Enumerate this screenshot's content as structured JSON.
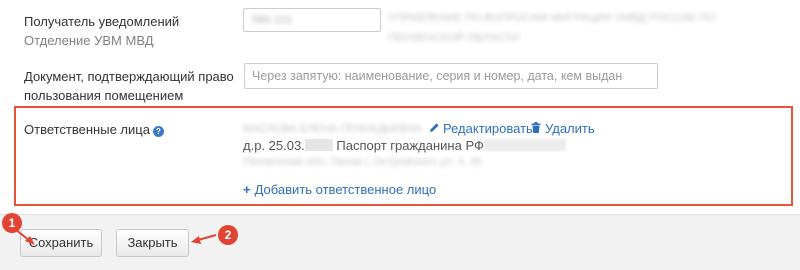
{
  "recipient": {
    "label": "Получатель уведомлений",
    "sublabel": "Отделение УВМ МВД",
    "code_value": "580-101",
    "authority_line1": "УПРАВЛЕНИЕ ПО ВОПРОСАМ МИГРАЦИИ УМВД РОССИИ ПО",
    "authority_line2": "ПЕНЗЕНСКОЙ ОБЛАСТИ"
  },
  "document": {
    "label": "Документ, подтверждающий право пользования помещением",
    "placeholder": "Через запятую: наименование, серия и номер, дата, кем выдан"
  },
  "responsible": {
    "label": "Ответственные лица",
    "help_icon": "question-circle-icon",
    "person_name": "МАСЛОВА ЕЛЕНА ГЕННАДЬЕВНА",
    "edit_label": "Редактировать",
    "edit_icon": "pencil-icon",
    "delete_label": "Удалить",
    "delete_icon": "trash-icon",
    "birth_prefix": "д.р. 25.03.",
    "passport_label": "Паспорт гражданина РФ",
    "address": "Пензенская обл, Пенза г, Островского ул, 4, 35",
    "add_label": "Добавить ответственное лицо",
    "add_icon": "plus-icon"
  },
  "footer": {
    "save_label": "Сохранить",
    "close_label": "Закрыть"
  },
  "annotations": {
    "marker1": "1",
    "marker2": "2"
  },
  "colors": {
    "link": "#2f6fba",
    "highlight_border": "#e8533a",
    "marker": "#e24434",
    "help_icon": "#3c7bc4"
  }
}
